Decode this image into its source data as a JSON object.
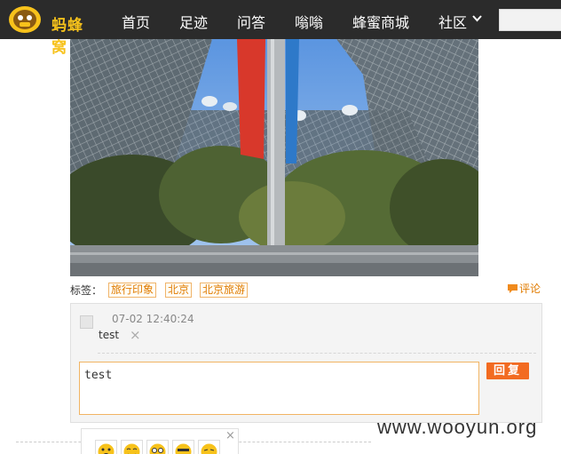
{
  "nav": {
    "logo_text": "蚂蜂窝",
    "items": [
      "首页",
      "足迹",
      "问答",
      "嗡嗡",
      "蜂蜜商城",
      "社区"
    ],
    "search_placeholder": ""
  },
  "tags": {
    "label": "标签：",
    "items": [
      "旅行印象",
      "北京",
      "北京旅游"
    ]
  },
  "comment_link": "评论",
  "comment": {
    "time": "07-02 12:40:24",
    "text": "test",
    "delete_glyph": "×"
  },
  "reply": {
    "input_value": "test",
    "button_label": "回复"
  },
  "emoji": {
    "close_glyph": "×",
    "count": 5
  },
  "watermark": "www.wooyun.org",
  "colors": {
    "nav_bg": "#2b2b2b",
    "accent": "#f26b21",
    "tag_border": "#f0b46a",
    "input_border": "#f1b463"
  }
}
